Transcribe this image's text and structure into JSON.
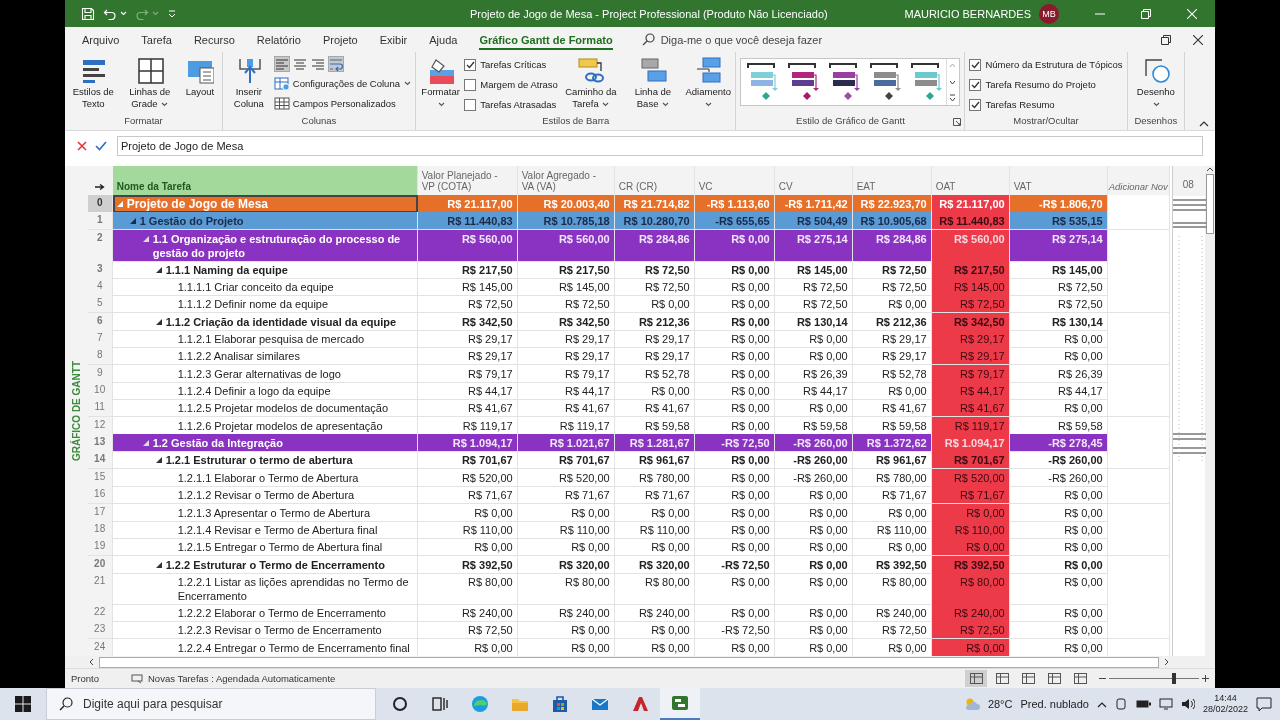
{
  "window": {
    "title": "Projeto de Jogo de Mesa  -  Project Professional (Produto Não Licenciado)",
    "user": "MAURICIO BERNARDES",
    "user_initials": "MB"
  },
  "menu": [
    {
      "label": "Arquivo",
      "selected": false
    },
    {
      "label": "Tarefa",
      "selected": false
    },
    {
      "label": "Recurso",
      "selected": false
    },
    {
      "label": "Relatório",
      "selected": false
    },
    {
      "label": "Projeto",
      "selected": false
    },
    {
      "label": "Exibir",
      "selected": false
    },
    {
      "label": "Ajuda",
      "selected": false
    },
    {
      "label": "Gráfico Gantt de Formato",
      "selected": true
    }
  ],
  "tell_me": {
    "placeholder": "Diga-me o que você deseja fazer"
  },
  "ribbon": [
    {
      "label": "Formatar",
      "items": [
        {
          "kind": "large",
          "label": "Estilos de Texto",
          "dropdown": false
        },
        {
          "kind": "large",
          "label": "Linhas de Grade",
          "dropdown": true
        },
        {
          "kind": "large",
          "label": "Layout",
          "dropdown": false
        }
      ]
    },
    {
      "label": "Colunas",
      "items": [
        {
          "kind": "large",
          "label": "Inserir Coluna",
          "dropdown": false
        },
        {
          "kind": "stack",
          "items": [
            {
              "kind": "toggles",
              "toggles": [
                {
                  "selected": true
                },
                {
                  "selected": false
                },
                {
                  "selected": false
                },
                {
                  "selected": true
                }
              ]
            },
            {
              "kind": "small",
              "label": "Configurações de Coluna",
              "dropdown": true
            },
            {
              "kind": "small",
              "label": "Campos Personalizados",
              "dropdown": false
            }
          ]
        }
      ]
    },
    {
      "label": "Estilos de Barra",
      "items": [
        {
          "kind": "large",
          "label": "Formatar",
          "dropdown": true
        },
        {
          "kind": "stack",
          "items": [
            {
              "kind": "check",
              "label": "Tarefas Críticas",
              "checked": true
            },
            {
              "kind": "check",
              "label": "Margem de Atraso",
              "checked": false
            },
            {
              "kind": "check",
              "label": "Tarefas Atrasadas",
              "checked": false
            }
          ]
        },
        {
          "kind": "large",
          "label": "Caminho da Tarefa",
          "dropdown": true
        },
        {
          "kind": "large",
          "label": "Linha de Base",
          "dropdown": true
        },
        {
          "kind": "large",
          "label": "Adiamento",
          "dropdown": true
        }
      ]
    },
    {
      "label": "Estilo de Gráfico de Gantt",
      "launcher": true,
      "items": [
        {
          "kind": "gallery",
          "styles": [
            {
              "color": "#7fd0d6"
            },
            {
              "color": "#b0267a"
            },
            {
              "color": "#9a3fa0"
            },
            {
              "color": "#8c8c8c"
            },
            {
              "color": "#6cc9d0"
            }
          ]
        }
      ]
    },
    {
      "label": "Mostrar/Ocultar",
      "items": [
        {
          "kind": "stack",
          "items": [
            {
              "kind": "check",
              "label": "Número da Estrutura de Tópicos",
              "checked": true
            },
            {
              "kind": "check",
              "label": "Tarefa Resumo do Projeto",
              "checked": true
            },
            {
              "kind": "check",
              "label": "Tarefas Resumo",
              "checked": true
            }
          ]
        }
      ]
    },
    {
      "label": "Desenhos",
      "items": [
        {
          "kind": "large",
          "label": "Desenho",
          "dropdown": true
        }
      ]
    }
  ],
  "entry_bar": {
    "value": "Projeto de Jogo de Mesa"
  },
  "side_label": "GRÁFICO DE GANTT",
  "table": {
    "columns": [
      {
        "label": "Nome da Tarefa",
        "kind": "name",
        "selected": true
      },
      {
        "label": "Valor Planejado - VP (COTA)",
        "kind": "value",
        "selected": false
      },
      {
        "label": "Valor Agregado - VA (VA)",
        "kind": "value",
        "selected": false
      },
      {
        "label": "CR (CR)",
        "kind": "value",
        "selected": false
      },
      {
        "label": "VC",
        "kind": "value",
        "selected": false
      },
      {
        "label": "CV",
        "kind": "value",
        "selected": false
      },
      {
        "label": "EAT",
        "kind": "value",
        "selected": false
      },
      {
        "label": "OAT",
        "kind": "value",
        "selected": false,
        "color": "#ec3a48"
      },
      {
        "label": "VAT",
        "kind": "value",
        "selected": false
      },
      {
        "label": "Adicionar Nov",
        "kind": "add",
        "selected": false
      }
    ],
    "rows": [
      {
        "id": "0",
        "name": "Projeto de Jogo de Mesa",
        "kind": "project",
        "color": "#e66f2a",
        "expanded": true,
        "selected": true,
        "values": [
          "R$ 21.117,00",
          "R$ 20.003,40",
          "R$ 21.714,82",
          "-R$ 1.113,60",
          "-R$ 1.711,42",
          "R$ 22.923,70",
          "R$ 21.117,00",
          "-R$ 1.806,70"
        ],
        "children": [
          {
            "id": "1",
            "name": "1 Gestão do Projeto",
            "kind": "phase",
            "color": "#5b9bd5",
            "expanded": true,
            "selected": false,
            "values": [
              "R$ 11.440,83",
              "R$ 10.785,18",
              "R$ 10.280,70",
              "-R$ 655,65",
              "R$ 504,49",
              "R$ 10.905,68",
              "R$ 11.440,83",
              "R$ 535,15"
            ],
            "children": [
              {
                "id": "2",
                "name": "1.1 Organização e estruturação do processo de gestão do projeto",
                "kind": "group",
                "color": "#8a32c2",
                "expanded": true,
                "selected": false,
                "values": [
                  "R$ 560,00",
                  "R$ 560,00",
                  "R$ 284,86",
                  "R$ 0,00",
                  "R$ 275,14",
                  "R$ 284,86",
                  "R$ 560,00",
                  "R$ 275,14"
                ],
                "children": [
                  {
                    "id": "3",
                    "name": "1.1.1 Naming da equipe",
                    "kind": "summary",
                    "expanded": true,
                    "selected": false,
                    "values": [
                      "R$ 217,50",
                      "R$ 217,50",
                      "R$ 72,50",
                      "R$ 0,00",
                      "R$ 145,00",
                      "R$ 72,50",
                      "R$ 217,50",
                      "R$ 145,00"
                    ],
                    "children": [
                      {
                        "id": "4",
                        "name": "1.1.1.1 Criar conceito da equipe",
                        "kind": "task",
                        "selected": false,
                        "values": [
                          "R$ 145,00",
                          "R$ 145,00",
                          "R$ 72,50",
                          "R$ 0,00",
                          "R$ 72,50",
                          "R$ 72,50",
                          "R$ 145,00",
                          "R$ 72,50"
                        ]
                      },
                      {
                        "id": "5",
                        "name": "1.1.1.2 Definir nome da equipe",
                        "kind": "task",
                        "selected": false,
                        "values": [
                          "R$ 72,50",
                          "R$ 72,50",
                          "R$ 0,00",
                          "R$ 0,00",
                          "R$ 72,50",
                          "R$ 0,00",
                          "R$ 72,50",
                          "R$ 72,50"
                        ]
                      }
                    ]
                  },
                  {
                    "id": "6",
                    "name": "1.1.2 Criação da identidade visual da equipe",
                    "kind": "summary",
                    "expanded": true,
                    "selected": false,
                    "values": [
                      "R$ 342,50",
                      "R$ 342,50",
                      "R$ 212,36",
                      "R$ 0,00",
                      "R$ 130,14",
                      "R$ 212,36",
                      "R$ 342,50",
                      "R$ 130,14"
                    ],
                    "children": [
                      {
                        "id": "7",
                        "name": "1.1.2.1 Elaborar pesquisa de mercado",
                        "kind": "task",
                        "selected": false,
                        "values": [
                          "R$ 29,17",
                          "R$ 29,17",
                          "R$ 29,17",
                          "R$ 0,00",
                          "R$ 0,00",
                          "R$ 29,17",
                          "R$ 29,17",
                          "R$ 0,00"
                        ]
                      },
                      {
                        "id": "8",
                        "name": "1.1.2.2 Analisar similares",
                        "kind": "task",
                        "selected": false,
                        "values": [
                          "R$ 29,17",
                          "R$ 29,17",
                          "R$ 29,17",
                          "R$ 0,00",
                          "R$ 0,00",
                          "R$ 29,17",
                          "R$ 29,17",
                          "R$ 0,00"
                        ]
                      },
                      {
                        "id": "9",
                        "name": "1.1.2.3 Gerar alternativas de logo",
                        "kind": "task",
                        "selected": false,
                        "values": [
                          "R$ 79,17",
                          "R$ 79,17",
                          "R$ 52,78",
                          "R$ 0,00",
                          "R$ 26,39",
                          "R$ 52,78",
                          "R$ 79,17",
                          "R$ 26,39"
                        ]
                      },
                      {
                        "id": "10",
                        "name": "1.1.2.4 Definir a logo da equipe",
                        "kind": "task",
                        "selected": false,
                        "values": [
                          "R$ 44,17",
                          "R$ 44,17",
                          "R$ 0,00",
                          "R$ 0,00",
                          "R$ 44,17",
                          "R$ 0,00",
                          "R$ 44,17",
                          "R$ 44,17"
                        ]
                      },
                      {
                        "id": "11",
                        "name": "1.1.2.5 Projetar modelos de documentação",
                        "kind": "task",
                        "selected": false,
                        "values": [
                          "R$ 41,67",
                          "R$ 41,67",
                          "R$ 41,67",
                          "R$ 0,00",
                          "R$ 0,00",
                          "R$ 41,67",
                          "R$ 41,67",
                          "R$ 0,00"
                        ]
                      },
                      {
                        "id": "12",
                        "name": "1.1.2.6 Projetar modelos de apresentação",
                        "kind": "task",
                        "selected": false,
                        "values": [
                          "R$ 119,17",
                          "R$ 119,17",
                          "R$ 59,58",
                          "R$ 0,00",
                          "R$ 59,58",
                          "R$ 59,58",
                          "R$ 119,17",
                          "R$ 59,58"
                        ]
                      }
                    ]
                  }
                ]
              },
              {
                "id": "13",
                "name": "1.2 Gestão da Integração",
                "kind": "group",
                "color": "#8a32c2",
                "expanded": true,
                "selected": false,
                "values": [
                  "R$ 1.094,17",
                  "R$ 1.021,67",
                  "R$ 1.281,67",
                  "-R$ 72,50",
                  "-R$ 260,00",
                  "R$ 1.372,62",
                  "R$ 1.094,17",
                  "-R$ 278,45"
                ],
                "children": [
                  {
                    "id": "14",
                    "name": "1.2.1 Estruturar o termo de abertura",
                    "kind": "summary",
                    "expanded": true,
                    "selected": false,
                    "values": [
                      "R$ 701,67",
                      "R$ 701,67",
                      "R$ 961,67",
                      "R$ 0,00",
                      "-R$ 260,00",
                      "R$ 961,67",
                      "R$ 701,67",
                      "-R$ 260,00"
                    ],
                    "children": [
                      {
                        "id": "15",
                        "name": "1.2.1.1 Elaborar o Termo de Abertura",
                        "kind": "task",
                        "selected": false,
                        "values": [
                          "R$ 520,00",
                          "R$ 520,00",
                          "R$ 780,00",
                          "R$ 0,00",
                          "-R$ 260,00",
                          "R$ 780,00",
                          "R$ 520,00",
                          "-R$ 260,00"
                        ]
                      },
                      {
                        "id": "16",
                        "name": "1.2.1.2 Revisar o Termo de Abertura",
                        "kind": "task",
                        "selected": false,
                        "values": [
                          "R$ 71,67",
                          "R$ 71,67",
                          "R$ 71,67",
                          "R$ 0,00",
                          "R$ 0,00",
                          "R$ 71,67",
                          "R$ 71,67",
                          "R$ 0,00"
                        ]
                      },
                      {
                        "id": "17",
                        "name": "1.2.1.3 Apresentar o Termo de Abertura",
                        "kind": "task",
                        "selected": false,
                        "values": [
                          "R$ 0,00",
                          "R$ 0,00",
                          "R$ 0,00",
                          "R$ 0,00",
                          "R$ 0,00",
                          "R$ 0,00",
                          "R$ 0,00",
                          "R$ 0,00"
                        ]
                      },
                      {
                        "id": "18",
                        "name": "1.2.1.4 Revisar e Termo de Abertura final",
                        "kind": "task",
                        "selected": false,
                        "values": [
                          "R$ 110,00",
                          "R$ 110,00",
                          "R$ 110,00",
                          "R$ 0,00",
                          "R$ 0,00",
                          "R$ 110,00",
                          "R$ 110,00",
                          "R$ 0,00"
                        ]
                      },
                      {
                        "id": "19",
                        "name": "1.2.1.5 Entregar o Termo de Abertura final",
                        "kind": "task",
                        "selected": false,
                        "values": [
                          "R$ 0,00",
                          "R$ 0,00",
                          "R$ 0,00",
                          "R$ 0,00",
                          "R$ 0,00",
                          "R$ 0,00",
                          "R$ 0,00",
                          "R$ 0,00"
                        ]
                      }
                    ]
                  },
                  {
                    "id": "20",
                    "name": "1.2.2 Estruturar o Termo de Encerramento",
                    "kind": "summary",
                    "expanded": true,
                    "selected": false,
                    "values": [
                      "R$ 392,50",
                      "R$ 320,00",
                      "R$ 320,00",
                      "-R$ 72,50",
                      "R$ 0,00",
                      "R$ 392,50",
                      "R$ 392,50",
                      "R$ 0,00"
                    ],
                    "children": [
                      {
                        "id": "21",
                        "name": "1.2.2.1 Listar as lições aprendidas no Termo de Encerramento",
                        "kind": "task",
                        "selected": false,
                        "values": [
                          "R$ 80,00",
                          "R$ 80,00",
                          "R$ 80,00",
                          "R$ 0,00",
                          "R$ 0,00",
                          "R$ 80,00",
                          "R$ 80,00",
                          "R$ 0,00"
                        ]
                      },
                      {
                        "id": "22",
                        "name": "1.2.2.2 Elaborar o Termo de Encerramento",
                        "kind": "task",
                        "selected": false,
                        "values": [
                          "R$ 240,00",
                          "R$ 240,00",
                          "R$ 240,00",
                          "R$ 0,00",
                          "R$ 0,00",
                          "R$ 240,00",
                          "R$ 240,00",
                          "R$ 0,00"
                        ]
                      },
                      {
                        "id": "23",
                        "name": "1.2.2.3 Revisar o Termo de Encerramento",
                        "kind": "task",
                        "selected": false,
                        "values": [
                          "R$ 72,50",
                          "R$ 0,00",
                          "R$ 0,00",
                          "-R$ 72,50",
                          "R$ 0,00",
                          "R$ 72,50",
                          "R$ 72,50",
                          "R$ 0,00"
                        ]
                      },
                      {
                        "id": "24",
                        "name": "1.2.2.4 Entregar o Termo de Encerramento final",
                        "kind": "task",
                        "selected": false,
                        "values": [
                          "R$ 0,00",
                          "R$ 0,00",
                          "R$ 0,00",
                          "R$ 0,00",
                          "R$ 0,00",
                          "R$ 0,00",
                          "R$ 0,00",
                          "R$ 0,00"
                        ]
                      }
                    ]
                  }
                ]
              }
            ]
          }
        ]
      }
    ]
  },
  "gantt": {
    "timescale": "08"
  },
  "status_bar": {
    "state": "Pronto",
    "new_tasks": "Novas Tarefas : Agendada Automaticamente",
    "views": [
      {
        "selected": true
      },
      {
        "selected": false
      },
      {
        "selected": false
      },
      {
        "selected": false
      },
      {
        "selected": false
      }
    ],
    "zoom": {
      "level": 0.72
    }
  },
  "taskbar": {
    "search": {
      "placeholder": "Digite aqui para pesquisar"
    },
    "apps": [
      {
        "selected": false
      },
      {
        "selected": false
      },
      {
        "selected": false
      },
      {
        "selected": false
      },
      {
        "selected": false
      },
      {
        "selected": false
      },
      {
        "selected": false
      },
      {
        "selected": true
      }
    ],
    "temperature": "28°C",
    "weather": "Pred. nublado",
    "time": "14:44",
    "date": "28/02/2022"
  }
}
